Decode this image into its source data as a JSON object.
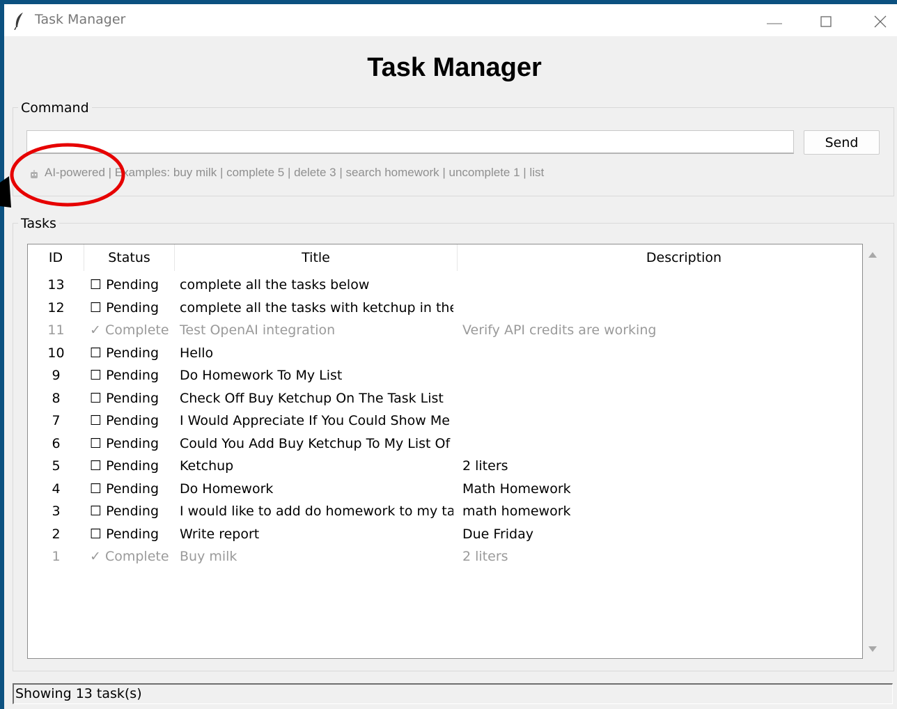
{
  "window": {
    "title": "Task Manager"
  },
  "app": {
    "heading": "Task Manager"
  },
  "command": {
    "group_label": "Command",
    "input_value": "",
    "send_label": "Send",
    "hint": "AI-powered | Examples: buy milk | complete 5 | delete 3 | search homework | uncomplete 1 | list"
  },
  "tasks": {
    "group_label": "Tasks",
    "columns": {
      "id": "ID",
      "status": "Status",
      "title": "Title",
      "description": "Description"
    },
    "rows": [
      {
        "id": "13",
        "status": "☐ Pending",
        "title": "complete all the tasks below",
        "description": "",
        "complete": false
      },
      {
        "id": "12",
        "status": "☐ Pending",
        "title": "complete all the tasks with ketchup in the nan",
        "description": "",
        "complete": false
      },
      {
        "id": "11",
        "status": "✓ Complete",
        "title": "Test OpenAI integration",
        "description": "Verify API credits are working",
        "complete": true
      },
      {
        "id": "10",
        "status": "☐ Pending",
        "title": "Hello",
        "description": "",
        "complete": false
      },
      {
        "id": "9",
        "status": "☐ Pending",
        "title": "Do Homework To My List",
        "description": "",
        "complete": false
      },
      {
        "id": "8",
        "status": "☐ Pending",
        "title": "Check Off Buy Ketchup On The Task List",
        "description": "",
        "complete": false
      },
      {
        "id": "7",
        "status": "☐ Pending",
        "title": "I Would Appreciate If You Could Show Me A L",
        "description": "",
        "complete": false
      },
      {
        "id": "6",
        "status": "☐ Pending",
        "title": "Could You Add Buy Ketchup To My List Of Ta",
        "description": "",
        "complete": false
      },
      {
        "id": "5",
        "status": "☐ Pending",
        "title": "Ketchup",
        "description": "2 liters",
        "complete": false
      },
      {
        "id": "4",
        "status": "☐ Pending",
        "title": "Do Homework",
        "description": "Math Homework",
        "complete": false
      },
      {
        "id": "3",
        "status": "☐ Pending",
        "title": "I would like to add do homework to my tasks",
        "description": "math homework",
        "complete": false
      },
      {
        "id": "2",
        "status": "☐ Pending",
        "title": "Write report",
        "description": "Due Friday",
        "complete": false
      },
      {
        "id": "1",
        "status": "✓ Complete",
        "title": "Buy milk",
        "description": "2 liters",
        "complete": true
      }
    ]
  },
  "statusbar": {
    "text": "Showing 13 task(s)"
  },
  "colors": {
    "desktop": "#0c5180",
    "window_bg": "#f0f0f0",
    "complete_text": "#9a9a9a",
    "annotation": "#e60000"
  },
  "icons": [
    "feather-icon",
    "minimize-icon",
    "maximize-icon",
    "close-icon",
    "robot-icon",
    "scroll-up-arrow-icon",
    "scroll-down-arrow-icon"
  ]
}
